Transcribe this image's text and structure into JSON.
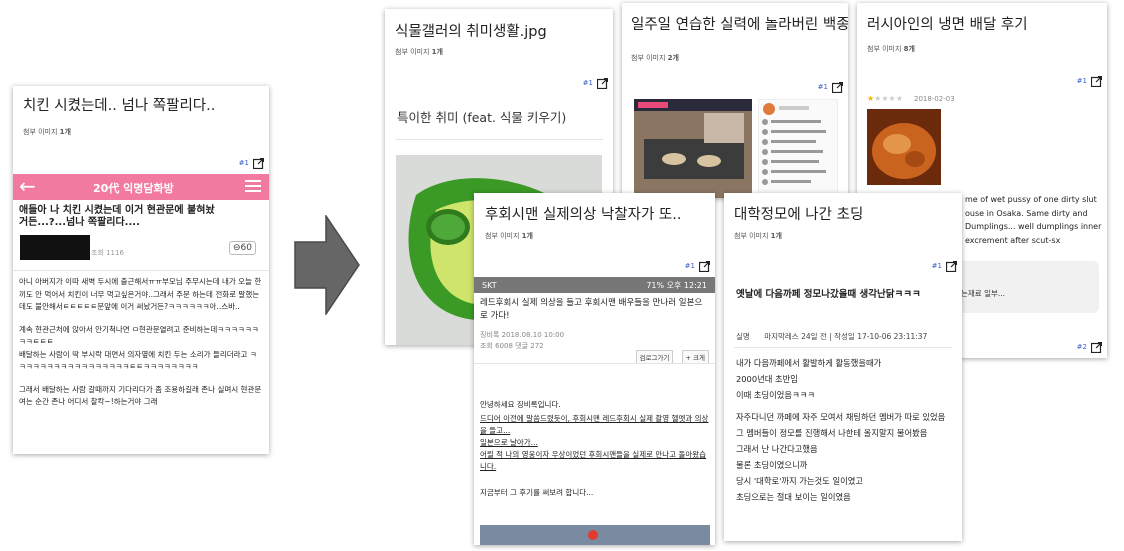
{
  "card1": {
    "title": "치킨 시켰는데.. 넘나 쪽팔리다..",
    "attach_prefix": "첨부 이미지",
    "attach_count": "1개",
    "footer_num": "#1",
    "app_title": "20代 익명담화방",
    "post_title": "애들아 나 치킨 시켰는데 이거 현관문에 붙혀놨거든...?...넘나 쪽팔리다....",
    "views": "조회 1116",
    "comment_count": "60",
    "body": [
      "아니 아버지가 이따 새벽 두시에 출근해서ㅠㅠ부모님 주무시는데 내가 오늘 한끼도 안 먹어서 치킨이 너무 먹고싶은거야..그래서 주문 하는데 전화로 말했는데도 불안해서ㅌㅌㅌㅌㅌ문앞에 이거 써놨거든?ㅋㅋㅋㅋㅋㅋ아..스바..",
      "계속 현관근처에 앉아서 안기척나면 ㅁ현관문열려고 준비하는데ㅋㅋㅋㅋㅋㅋㅋㅋㅌㅌㅌ",
      "배달하는 사람이 딱 부시락 대면서 의자옆에 치킨 두는 소리가 들리더라고 ㅋㅋㅋㅋㅋㅋㅋㅋㅋㅋㅋㅋㅋㅋㅋㅋㅋㅌㅌㅋㅋㅋㅋㅋㅋㅋㅋ",
      "그래서 배달하는 사람 갈때까지 기다리다가 좀 조용하길래 존나 실며시 현관문 여는 순간 존나 어디서 찰칵~!하는거야 그래"
    ]
  },
  "card2": {
    "title": "식물갤러의 취미생활.jpg",
    "attach_prefix": "첨부 이미지",
    "attach_count": "1개",
    "footer_num": "#1",
    "inner_title": "특이한 취미 (feat. 식물 키우기)"
  },
  "card3": {
    "title": "일주일 연습한 실력에 놀라버린 백종원",
    "attach_prefix": "첨부 이미지",
    "attach_count": "2개",
    "footer_num": "#1"
  },
  "card4": {
    "title": "러시아인의 냉면 배달 후기",
    "attach_prefix": "첨부 이미지",
    "attach_count": "8개",
    "footer_num": "#1",
    "date": "2018-02-03",
    "review_lines": [
      "me of wet pussy of one dirty slut",
      "ouse in Osaka. Same dirty and",
      "Dumplings... well dumplings inner",
      "excrement after scut-sx"
    ],
    "grey_box_text": "는재료 일부...",
    "footer_num2": "#2"
  },
  "card5": {
    "title": "후회시맨 실제의상 낙찰자가 또..",
    "attach_prefix": "첨부 이미지",
    "attach_count": "1개",
    "footer_num": "#1",
    "carrier": "SKT",
    "status_right": "71% 오후 12:21",
    "post_title": "레드후회시 실제 의상을 들고 후회시맨 배우들을 만나러 일본으로 가다!",
    "author": "징비록",
    "post_date": "2018.08.10 10:00",
    "meta": "조회 6008 댓글 272",
    "btn1": "검로그가기",
    "btn2": "+ 크게",
    "body_lines": [
      "안녕하세요 징비록입니다.",
      "드디어 이전에 말씀드렸듯이, 후회시맨 레드후회시 실제 촬영 헬멧과 의상을 들고...",
      "일본으로 날아가...",
      "어릴 적 나의 영웅이자 우상이었던 후회시맨들을 실제로 만나고 돌아왔습니다.",
      "지금부터 그 후기를 써보려 합니다..."
    ]
  },
  "card6": {
    "title": "대학정모에 나간 초딩",
    "attach_prefix": "첨부 이미지",
    "attach_count": "1개",
    "footer_num": "#1",
    "post_title": "옛날에 다음까페 정모나갔을때 생각난닭ㅋㅋㅋ",
    "author_tag": "실명",
    "meta": "마지막레스 24일 전 | 작성일 17-10-06 23:11:37",
    "body_lines": [
      "내가 다음까페에서 활발하게 활동했을때가",
      "2000년대 초반임",
      "이때 초딩이었음ㅋㅋㅋ",
      "자주다니던 까페에 자주 모여서 채팅하던 멤버가 따로 있었음",
      "그 멤버들이 정모를 진행해서 나한테 올지말지 물어봤음",
      "그래서 난 나간다고했음",
      "물론 초딩이였으니까",
      "당시 '대학로'까지 가는것도 일이였고",
      "초딩으로는 절대 보이는 일이였음"
    ]
  }
}
